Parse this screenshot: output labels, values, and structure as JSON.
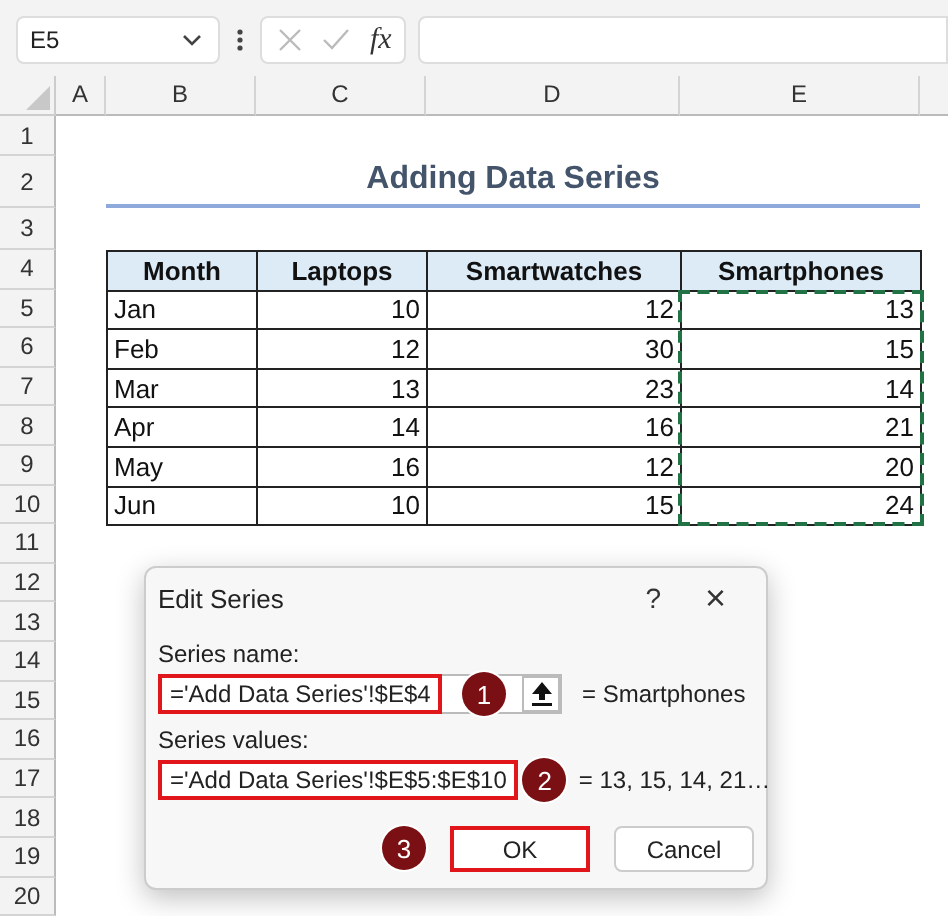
{
  "formula_bar": {
    "name_box": "E5",
    "function_label": "fx"
  },
  "sheet": {
    "columns": [
      "A",
      "B",
      "C",
      "D",
      "E"
    ],
    "rows": [
      "1",
      "2",
      "3",
      "4",
      "5",
      "6",
      "7",
      "8",
      "9",
      "10",
      "11",
      "12",
      "13",
      "14",
      "15",
      "16",
      "17",
      "18",
      "19",
      "20"
    ],
    "title": "Adding Data Series",
    "table": {
      "columns": [
        {
          "label": "Month",
          "marquee": false
        },
        {
          "label": "Laptops",
          "marquee": false
        },
        {
          "label": "Smartwatches",
          "marquee": false
        },
        {
          "label": "Smartphones",
          "marquee": true
        }
      ],
      "rows": [
        [
          "Jan",
          "10",
          "12",
          "13"
        ],
        [
          "Feb",
          "12",
          "30",
          "15"
        ],
        [
          "Mar",
          "13",
          "23",
          "14"
        ],
        [
          "Apr",
          "14",
          "16",
          "21"
        ],
        [
          "May",
          "16",
          "12",
          "20"
        ],
        [
          "Jun",
          "10",
          "15",
          "24"
        ]
      ]
    }
  },
  "dialog": {
    "title": "Edit Series",
    "help": "?",
    "close": "×",
    "fields": [
      {
        "label": "Series name:",
        "value": "='Add Data Series'!$E$4",
        "highlighted": true,
        "badge": "1",
        "collapse_button": true,
        "result": "= Smartphones"
      },
      {
        "label": "Series values:",
        "value": "='Add Data Series'!$E$5:$E$10",
        "highlighted": true,
        "badge": "2",
        "collapse_button": false,
        "result": "= 13, 15, 14, 21…"
      }
    ],
    "buttons": [
      {
        "label": "OK",
        "highlighted": true,
        "badge": "3"
      },
      {
        "label": "Cancel",
        "highlighted": false
      }
    ]
  }
}
